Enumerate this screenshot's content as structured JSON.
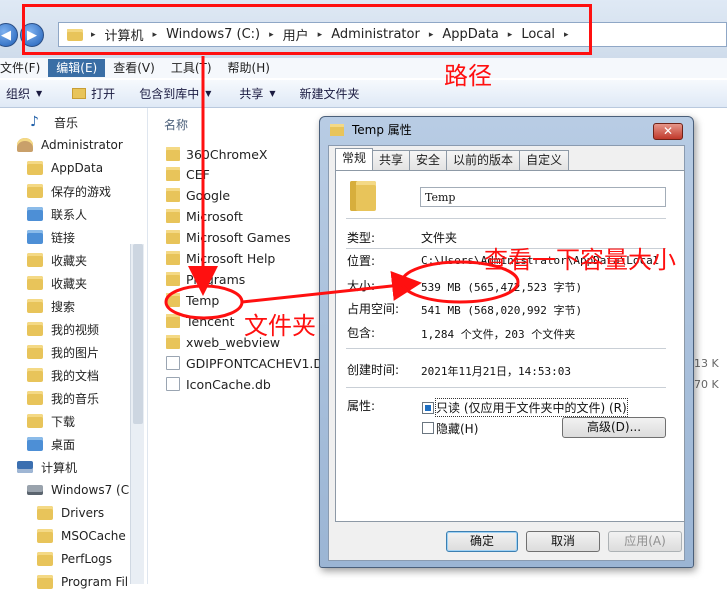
{
  "nav": {
    "back_glyph": "◀",
    "forward_glyph": "▶"
  },
  "address": {
    "crumbs": [
      "计算机",
      "Windows7 (C:)",
      "用户",
      "Administrator",
      "AppData",
      "Local"
    ],
    "separator": "▸"
  },
  "menu": [
    "文件(F)",
    "编辑(E)",
    "查看(V)",
    "工具(T)",
    "帮助(H)"
  ],
  "toolbar": {
    "organize": "组织",
    "open": "打开",
    "include": "包含到库中",
    "share": "共享",
    "new_folder": "新建文件夹"
  },
  "sidebar": {
    "items": [
      "音乐",
      "Administrator",
      "AppData",
      "保存的游戏",
      "联系人",
      "链接",
      "收藏夹",
      "收藏夹",
      "搜索",
      "我的视频",
      "我的图片",
      "我的文档",
      "我的音乐",
      "下载",
      "桌面",
      "计算机",
      "Windows7 (C:",
      "Drivers",
      "MSOCache",
      "PerfLogs",
      "Program Fil"
    ]
  },
  "content": {
    "column_name": "名称",
    "files": [
      "360ChromeX",
      "CEF",
      "Google",
      "Microsoft",
      "Microsoft Games",
      "Microsoft Help",
      "Programs",
      "Temp",
      "Tencent",
      "xweb_webview",
      "GDIPFONTCACHEV1.DA",
      "IconCache.db"
    ],
    "sizes": [
      "13 K",
      "70 K"
    ]
  },
  "annotations": {
    "path": "路径",
    "folder": "文件夹",
    "size_note": "查看一下容量大小"
  },
  "dialog": {
    "title": "Temp 属性",
    "close": "✕",
    "tabs": [
      "常规",
      "共享",
      "安全",
      "以前的版本",
      "自定义"
    ],
    "name": "Temp",
    "type_label": "类型:",
    "type_value": "文件夹",
    "location_label": "位置:",
    "location_value": "C:\\Users\\Administrator\\AppData\\Local",
    "size_label": "大小:",
    "size_value": "539 MB (565,472,523 字节)",
    "disk_label": "占用空间:",
    "disk_value": "541 MB (568,020,992 字节)",
    "contains_label": "包含:",
    "contains_value": "1,284 个文件，203 个文件夹",
    "created_label": "创建时间:",
    "created_value": "2021年11月21日，14:53:03",
    "attr_label": "属性:",
    "readonly_label": "只读 (仅应用于文件夹中的文件) (R)",
    "hidden_label": "隐藏(H)",
    "advanced_label": "高级(D)...",
    "ok": "确定",
    "cancel": "取消",
    "apply": "应用(A)"
  }
}
